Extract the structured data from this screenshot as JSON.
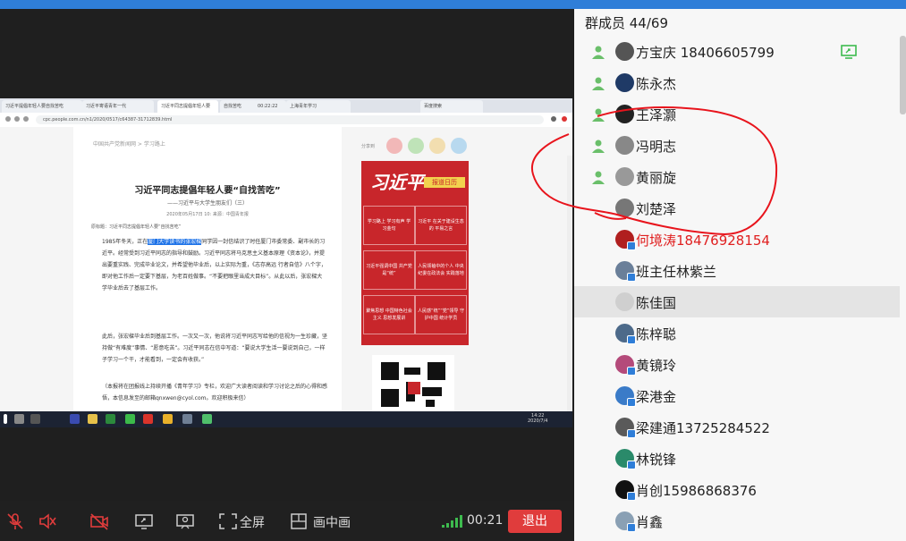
{
  "screen_share": {
    "tabs": [
      "习近平提倡年轻人要自找苦吃",
      "习近平寄语青年一代",
      "习近平同志提倡年轻人要",
      "自找苦吃",
      "00:22:22",
      "上海青年学习",
      "百度搜索"
    ],
    "url": "cpc.people.com.cn/n1/2020/0517/c64387-31712839.html",
    "breadcrumb": "中国共产党新闻网 > 学习路上",
    "share_label": "分享到",
    "article": {
      "title": "习近平同志提倡年轻人要“自找苦吃”",
      "subtitle": "——习近平与大学生朋友们（三）",
      "meta": "2020年05月17日 10:  来源：中国青年报",
      "source_line": "原标题：习近平同志提倡年轻人要“自找苦吃”",
      "para1_pre": "1985年冬天，正在",
      "para1_highlight": "厦门大学读书的张宏樑",
      "para1_post": "同学因一封信结识了时任厦门市委常委、副市长的习近平。经常受到习近平同志的指导和鼓励。习近平同志将马克思主义基本原理《资本论》，并提出要重实践、完成毕业论文，并希望他毕业后，以上实际为重，《志存高远 行者自信》八个字，即对他工作后一定要下基层，为老百姓做事。“不要把眼里当成大目标”。从此以后，张宏樑大学毕业后去了基层工作。",
      "para2": "此后，张宏樑毕业后到基层工作。一次又一次，他说将习近平同志写给他的信视为一生珍藏，坚持做“有难度”事情、“愿意吃苦”。习近平同志在信中写道：“要说大学生活一要说到自己，一样子学习一个干，才能看到，一定会有收获。”",
      "para3": "（本报将在团报线上持续开播《青年学习》专栏，欢迎广大读者阅读和学习讨论之后的心得和感悟，本信息发至的邮箱qnxwen@cyol.com。欢迎积极来信）"
    },
    "banner": {
      "title": "习近平",
      "tag": "报道日历",
      "cells": [
        "学习路上 学习有声 学习金句",
        "习近平 在关于建设生态的 平易之言",
        "习近平强调中国 共产党是“统”",
        "人民领袖中的个人 中央纪委在政法会 实践落地",
        "聚焦思想 中国特色社会主义 思想发展讲",
        "人民感“统”“党”领导 守护中国 统计学员"
      ]
    },
    "taskbar_time": "14:22",
    "taskbar_date": "2020/7/4"
  },
  "controls": {
    "fullscreen_label": "全屏",
    "pip_label": "画中画",
    "timer": "00:21",
    "exit_label": "退出"
  },
  "panel": {
    "title": "群成员 44/69",
    "members": [
      {
        "name": "方宝庆    18406605799",
        "red": false,
        "person": true,
        "badge": false,
        "sharing": true
      },
      {
        "name": "陈永杰",
        "red": false,
        "person": true,
        "badge": false,
        "sharing": false
      },
      {
        "name": "王泽灏",
        "red": false,
        "person": true,
        "badge": false,
        "sharing": false
      },
      {
        "name": "冯明志",
        "red": false,
        "person": true,
        "badge": false,
        "sharing": false
      },
      {
        "name": "黄丽旋",
        "red": false,
        "person": true,
        "badge": false,
        "sharing": false
      },
      {
        "name": "刘楚泽",
        "red": false,
        "person": false,
        "badge": false,
        "sharing": false
      },
      {
        "name": "何境涛18476928154",
        "red": true,
        "person": false,
        "badge": true,
        "sharing": false
      },
      {
        "name": "班主任林紫兰",
        "red": false,
        "person": false,
        "badge": true,
        "sharing": false
      },
      {
        "name": "陈佳国",
        "red": false,
        "person": false,
        "badge": false,
        "sharing": false
      },
      {
        "name": "陈梓聪",
        "red": false,
        "person": false,
        "badge": true,
        "sharing": false
      },
      {
        "name": "黄镜玲",
        "red": false,
        "person": false,
        "badge": true,
        "sharing": false
      },
      {
        "name": "梁港金",
        "red": false,
        "person": false,
        "badge": true,
        "sharing": false
      },
      {
        "name": "梁建通13725284522",
        "red": false,
        "person": false,
        "badge": true,
        "sharing": false
      },
      {
        "name": "林锐锋",
        "red": false,
        "person": false,
        "badge": true,
        "sharing": false
      },
      {
        "name": "肖创15986868376",
        "red": false,
        "person": false,
        "badge": true,
        "sharing": false
      },
      {
        "name": "肖鑫",
        "red": false,
        "person": false,
        "badge": true,
        "sharing": false
      }
    ],
    "selected_index": 8
  },
  "colors": {
    "accent": "#2f7ed8",
    "exit": "#e03c3c",
    "annotation": "#e8141c",
    "person_icon": "#6abf6a",
    "highlight_name": "#e02020"
  }
}
